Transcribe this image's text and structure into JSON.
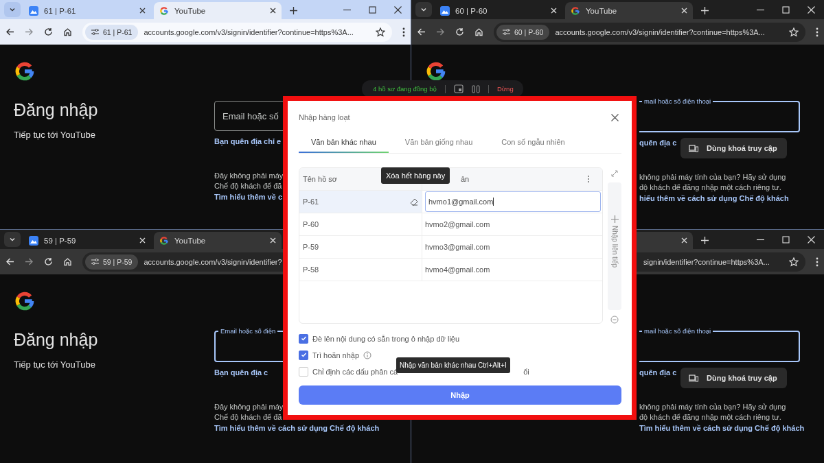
{
  "windows": [
    {
      "focused": true,
      "tabs": [
        {
          "label": "61 | P-61",
          "kind": "app",
          "selected": false
        },
        {
          "label": "YouTube",
          "kind": "google",
          "selected": true
        }
      ],
      "profile": "61 | P-61",
      "url": "accounts.google.com/v3/signin/identifier?continue=https%3A...",
      "page": {
        "heading": "Đăng nhập",
        "subheading": "Tiếp tục tới YouTube",
        "email_field": {
          "focused": false,
          "label": "Email hoặc số"
        },
        "forgot_link": "Bạn quên địa chỉ e",
        "guest_lines": [
          "Đây không phải máy",
          "Chế độ khách để đă"
        ],
        "learn_link": "Tìm hiểu thêm về c"
      }
    },
    {
      "focused": false,
      "tabs": [
        {
          "label": "60 | P-60",
          "kind": "app",
          "selected": false
        },
        {
          "label": "YouTube",
          "kind": "google",
          "selected": true
        }
      ],
      "profile": "60 | P-60",
      "url": "accounts.google.com/v3/signin/identifier?continue=https%3A...",
      "page": {
        "email_field": {
          "focused": true,
          "label": "mail hoặc số điện thoại"
        },
        "forgot_link": "quên địa c",
        "passkey_tooltip": "Dùng khoá truy cập",
        "guest_lines": [
          "không phải máy tính của bạn? Hãy sử dụng",
          "độ khách để đăng nhập một cách riêng tư."
        ],
        "learn_link": "hiểu thêm về cách sử dụng Chế độ khách"
      }
    },
    {
      "focused": false,
      "tabs": [
        {
          "label": "59 | P-59",
          "kind": "app",
          "selected": false
        },
        {
          "label": "YouTube",
          "kind": "google",
          "selected": true
        }
      ],
      "profile": "59 | P-59",
      "url": "accounts.google.com/v3/signin/identifier?",
      "page": {
        "heading": "Đăng nhập",
        "subheading": "Tiếp tục tới YouTube",
        "email_field": {
          "focused": true,
          "label": "Email hoặc số điện"
        },
        "forgot_link": "Bạn quên địa c",
        "guest_lines": [
          "Đây không phải máy",
          "Chế độ khách để đă"
        ],
        "learn_link": "Tìm hiểu thêm về cách sử dụng Chế độ khách"
      }
    },
    {
      "focused": false,
      "tabs": [
        {
          "selected": true
        }
      ],
      "url": "signin/identifier?continue=https%3A...",
      "page": {
        "email_field": {
          "focused": true,
          "label": "mail hoặc số điện thoại"
        },
        "forgot_link": "quên địa c",
        "passkey_tooltip": "Dùng khoá truy cập",
        "guest_lines": [
          "không phải máy tính của bạn? Hãy sử dụng",
          "độ khách để đăng nhập một cách riêng tư."
        ],
        "learn_link": "Tìm hiểu thêm về cách sử dụng Chế độ khách"
      }
    }
  ],
  "sync_toolbar": {
    "status": "4 hồ sơ đang đồng bộ",
    "stop": "Dừng"
  },
  "dialog": {
    "title": "Nhập hàng loạt",
    "tabs": [
      {
        "label": "Văn bản khác nhau",
        "selected": true
      },
      {
        "label": "Văn bản giống nhau",
        "selected": false
      },
      {
        "label": "Con số ngẫu nhiên",
        "selected": false
      }
    ],
    "table": {
      "columns": [
        "Tên hồ sơ",
        "ản"
      ],
      "rows": [
        {
          "profile": "P-61",
          "value": "hvmo1@gmail.com",
          "selected": true
        },
        {
          "profile": "P-60",
          "value": "hvmo2@gmail.com",
          "selected": false
        },
        {
          "profile": "P-59",
          "value": "hvmo3@gmail.com",
          "selected": false
        },
        {
          "profile": "P-58",
          "value": "hvmo4@gmail.com",
          "selected": false
        }
      ]
    },
    "side_label": "Nhập liên tiếp",
    "options": [
      {
        "kind": "plain",
        "label": "Đè lên nội dung có sẵn trong ô nhập dữ liệu",
        "checked": true
      },
      {
        "kind": "info",
        "label": "Trì hoãn nhập",
        "checked": true
      },
      {
        "kind": "plain",
        "label": "Chỉ định các dấu phân cá",
        "checked": false,
        "tail": "ổi"
      }
    ],
    "submit": "Nhập",
    "row_tooltip": "Xóa hết hàng này",
    "submit_tooltip": "Nhập văn bản khác nhau Ctrl+Alt+I"
  }
}
